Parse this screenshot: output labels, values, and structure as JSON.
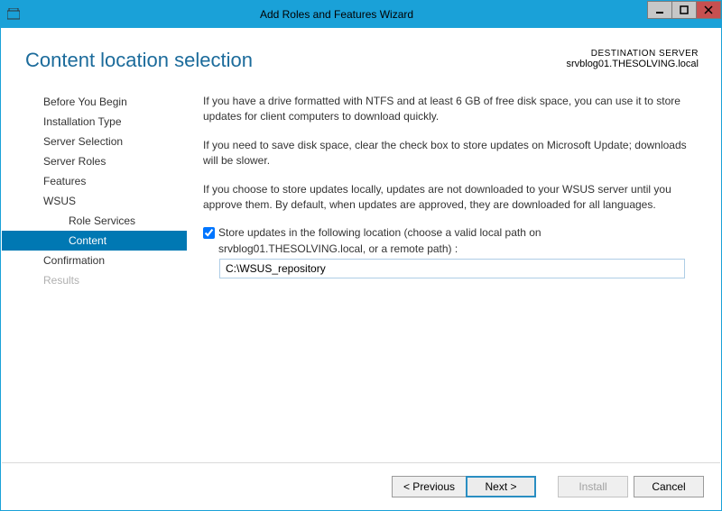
{
  "window": {
    "title": "Add Roles and Features Wizard"
  },
  "header": {
    "page_title": "Content location selection",
    "dest_label": "DESTINATION SERVER",
    "dest_server": "srvblog01.THESOLVING.local"
  },
  "sidebar": {
    "items": [
      {
        "label": "Before You Begin"
      },
      {
        "label": "Installation Type"
      },
      {
        "label": "Server Selection"
      },
      {
        "label": "Server Roles"
      },
      {
        "label": "Features"
      },
      {
        "label": "WSUS"
      },
      {
        "label": "Role Services"
      },
      {
        "label": "Content"
      },
      {
        "label": "Confirmation"
      },
      {
        "label": "Results"
      }
    ]
  },
  "main": {
    "p1": "If you have a drive formatted with NTFS and at least 6 GB of free disk space, you can use it to store updates for client computers to download quickly.",
    "p2": "If you need to save disk space, clear the check box to store updates on Microsoft Update; downloads will be slower.",
    "p3": "If you choose to store updates locally, updates are not downloaded to your WSUS server until you approve them. By default, when updates are approved, they are downloaded for all languages.",
    "check_label_1": "Store updates in the following location (choose a valid local path on",
    "check_label_2": "srvblog01.THESOLVING.local, or a remote path) :",
    "path_value": "C:\\WSUS_repository"
  },
  "footer": {
    "previous": "< Previous",
    "next": "Next >",
    "install": "Install",
    "cancel": "Cancel"
  }
}
